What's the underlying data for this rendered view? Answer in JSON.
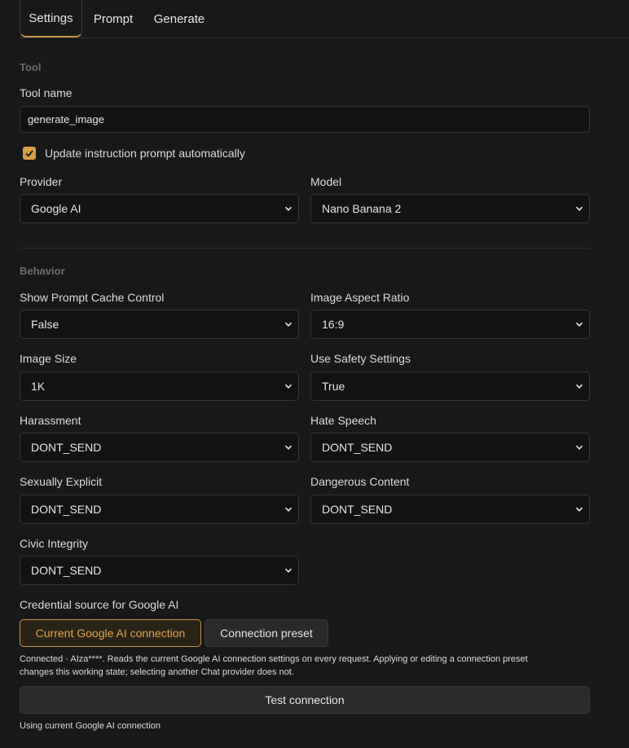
{
  "tabs": [
    {
      "label": "Settings",
      "active": true
    },
    {
      "label": "Prompt",
      "active": false
    },
    {
      "label": "Generate",
      "active": false
    }
  ],
  "tool_section": {
    "title": "Tool",
    "tool_name_label": "Tool name",
    "tool_name_value": "generate_image",
    "auto_update_label": "Update instruction prompt automatically",
    "auto_update_checked": true,
    "provider_label": "Provider",
    "provider_value": "Google AI",
    "model_label": "Model",
    "model_value": "Nano Banana 2"
  },
  "behavior_section": {
    "title": "Behavior",
    "show_prompt_cache_label": "Show Prompt Cache Control",
    "show_prompt_cache_value": "False",
    "aspect_ratio_label": "Image Aspect Ratio",
    "aspect_ratio_value": "16:9",
    "image_size_label": "Image Size",
    "image_size_value": "1K",
    "safety_label": "Use Safety Settings",
    "safety_value": "True",
    "harassment_label": "Harassment",
    "harassment_value": "DONT_SEND",
    "hate_speech_label": "Hate Speech",
    "hate_speech_value": "DONT_SEND",
    "sexually_explicit_label": "Sexually Explicit",
    "sexually_explicit_value": "DONT_SEND",
    "dangerous_content_label": "Dangerous Content",
    "dangerous_content_value": "DONT_SEND",
    "civic_integrity_label": "Civic Integrity",
    "civic_integrity_value": "DONT_SEND"
  },
  "credential": {
    "label": "Credential source for Google AI",
    "current_button": "Current Google AI connection",
    "preset_button": "Connection preset",
    "note_line1": "Connected · AIza****. Reads the current Google AI connection settings on every request. Applying or editing a connection preset",
    "note_line2": "changes this working state; selecting another Chat provider does not.",
    "test_button": "Test connection",
    "status": "Using current Google AI connection"
  },
  "colors": {
    "accent": "#c9954a",
    "checkbox": "#d79f45",
    "background": "#181818"
  }
}
